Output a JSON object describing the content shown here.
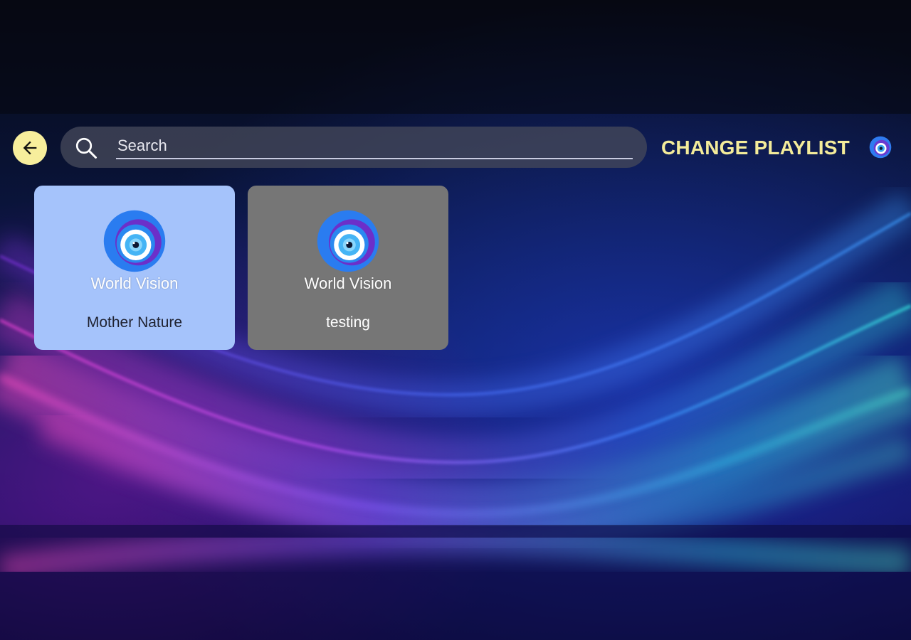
{
  "header": {
    "back_icon": "arrow-left-icon",
    "search": {
      "icon": "search-icon",
      "placeholder": "Search",
      "value": ""
    },
    "change_playlist_label": "CHANGE PLAYLIST",
    "profile_icon": "world-vision-eye-icon"
  },
  "playlists": [
    {
      "brand": "World Vision",
      "title": "Mother Nature",
      "selected": true,
      "icon": "world-vision-logo"
    },
    {
      "brand": "World Vision",
      "title": "testing",
      "selected": false,
      "icon": "world-vision-logo"
    }
  ],
  "colors": {
    "accent_yellow": "#f4ec9a",
    "selected_card": "#a5c3fb",
    "normal_card": "#767676",
    "search_background": "#44485a"
  }
}
